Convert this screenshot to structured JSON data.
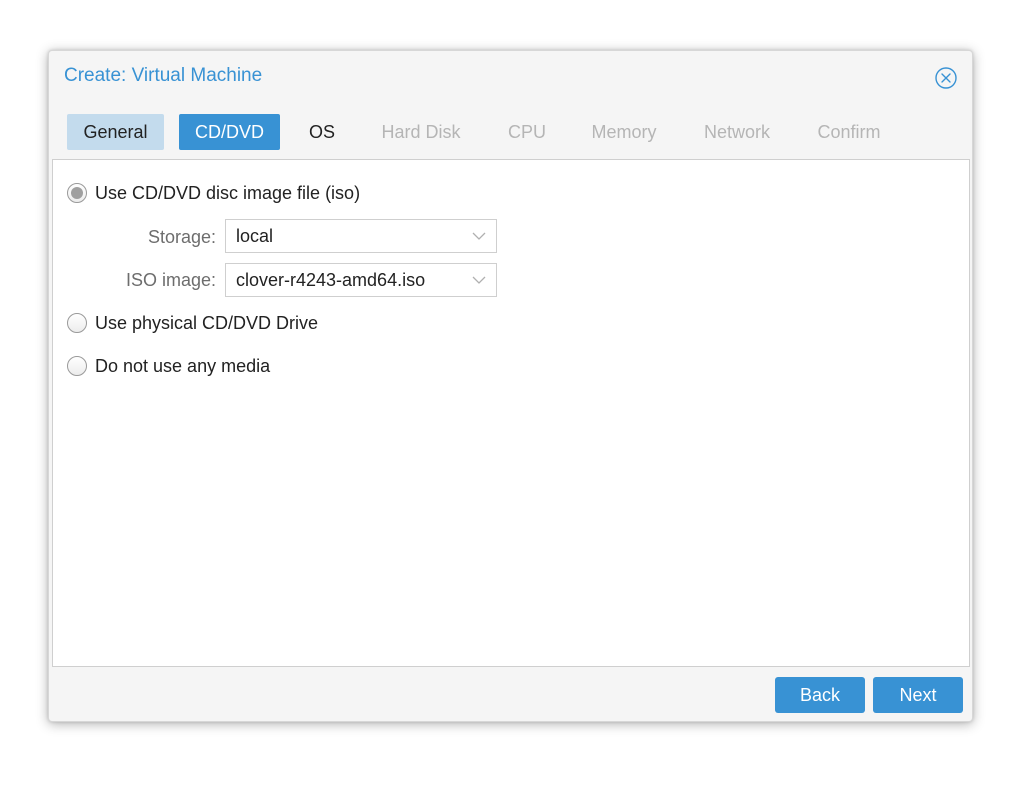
{
  "window": {
    "title": "Create: Virtual Machine"
  },
  "tabs": [
    {
      "label": "General",
      "state": "done"
    },
    {
      "label": "CD/DVD",
      "state": "active"
    },
    {
      "label": "OS",
      "state": "normal"
    },
    {
      "label": "Hard Disk",
      "state": "disabled"
    },
    {
      "label": "CPU",
      "state": "disabled"
    },
    {
      "label": "Memory",
      "state": "disabled"
    },
    {
      "label": "Network",
      "state": "disabled"
    },
    {
      "label": "Confirm",
      "state": "disabled"
    }
  ],
  "media": {
    "options": [
      {
        "label": "Use CD/DVD disc image file (iso)",
        "checked": true
      },
      {
        "label": "Use physical CD/DVD Drive",
        "checked": false
      },
      {
        "label": "Do not use any media",
        "checked": false
      }
    ],
    "storage": {
      "label": "Storage:",
      "value": "local"
    },
    "iso": {
      "label": "ISO image:",
      "value": "clover-r4243-amd64.iso"
    }
  },
  "footer": {
    "back_label": "Back",
    "next_label": "Next"
  },
  "colors": {
    "accent": "#3892d4",
    "tab_done": "#c3dbed",
    "disabled_text": "#b5b5b5"
  },
  "icons": {
    "close": "close-circle-icon",
    "dropdown": "chevron-down-icon"
  }
}
